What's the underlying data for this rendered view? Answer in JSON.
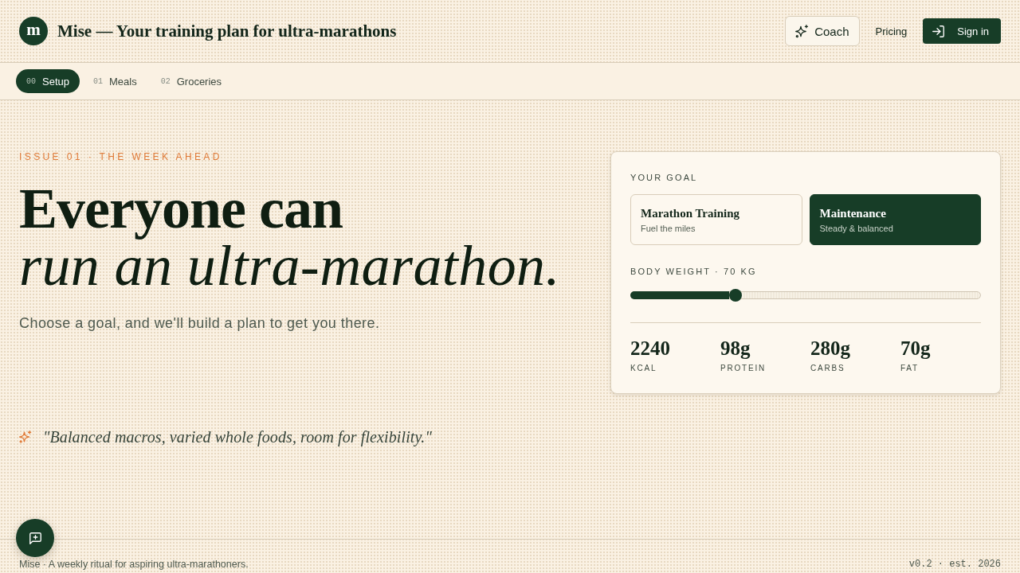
{
  "header": {
    "logo_letter": "m",
    "title": "Mise — Your training plan for ultra-marathons",
    "actions": [
      {
        "kind": "outline",
        "label": "Coach"
      },
      {
        "kind": "link",
        "label": "Pricing"
      },
      {
        "kind": "primary",
        "label": "Sign in"
      }
    ]
  },
  "tabs": [
    {
      "number": "00",
      "label": "Setup",
      "selected": true
    },
    {
      "number": "01",
      "label": "Meals",
      "selected": false
    },
    {
      "number": "02",
      "label": "Groceries",
      "selected": false
    }
  ],
  "hero": {
    "eyebrow": "ISSUE 01 · THE WEEK AHEAD",
    "headline": "Everyone can *run an ultra-marathon.*",
    "subtitle": "Choose a goal, and we'll build a plan to get you there.",
    "quote": "\"Balanced macros, varied whole foods, room for flexibility.\""
  },
  "goal_card": {
    "label": "YOUR GOAL",
    "options": [
      {
        "title": "Marathon Training",
        "subtitle": "Fuel the miles",
        "selected": false
      },
      {
        "title": "Maintenance",
        "subtitle": "Steady & balanced",
        "selected": true
      }
    ],
    "weight_label": "BODY WEIGHT · 70 KG",
    "weight_slider": {
      "level": 0.3
    },
    "macros": [
      {
        "value": "2240",
        "label": "KCAL"
      },
      {
        "value": "98g",
        "label": "PROTEIN"
      },
      {
        "value": "280g",
        "label": "CARBS"
      },
      {
        "value": "70g",
        "label": "FAT"
      }
    ]
  },
  "footer": {
    "tagline": "Mise · A weekly ritual for aspiring ultra-marathoners.",
    "version": "v0.2 · est. 2026"
  }
}
